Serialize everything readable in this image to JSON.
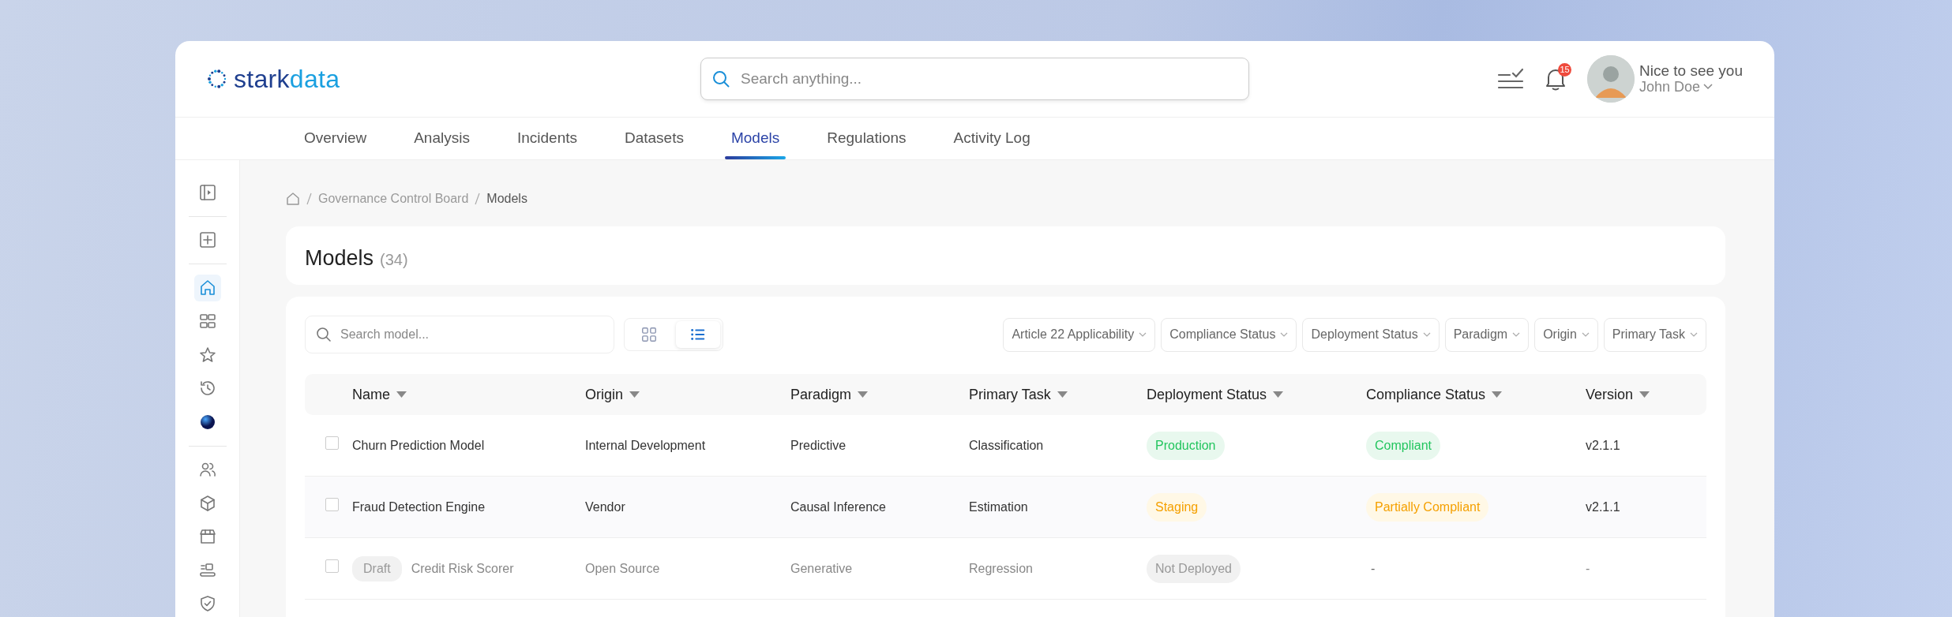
{
  "header": {
    "logo_text": [
      "stark",
      "data"
    ],
    "search": {
      "placeholder": "Search anything..."
    },
    "notifications": {
      "count": "15"
    },
    "user": {
      "greeting": "Nice to see you",
      "name": "John Doe"
    }
  },
  "tabs": [
    {
      "label": "Overview",
      "selected": false
    },
    {
      "label": "Analysis",
      "selected": false
    },
    {
      "label": "Incidents",
      "selected": false
    },
    {
      "label": "Datasets",
      "selected": false
    },
    {
      "label": "Models",
      "selected": true
    },
    {
      "label": "Regulations",
      "selected": false
    },
    {
      "label": "Activity Log",
      "selected": false
    }
  ],
  "sidebar": {
    "items": [
      {
        "selected": false
      },
      {
        "selected": false
      },
      {
        "selected": true
      },
      {
        "selected": false
      },
      {
        "selected": false
      },
      {
        "selected": false
      },
      {
        "selected": false
      },
      {
        "selected": false
      },
      {
        "selected": false
      },
      {
        "selected": false
      },
      {
        "selected": false
      },
      {
        "selected": false
      }
    ]
  },
  "breadcrumb": [
    "Governance Control Board",
    "Models"
  ],
  "page": {
    "title": "Models",
    "count": "(34)"
  },
  "toolbar": {
    "search": {
      "placeholder": "Search model..."
    },
    "views": [
      {
        "kind": "grid",
        "selected": false
      },
      {
        "kind": "list",
        "selected": true
      }
    ],
    "filters": [
      "Article 22 Applicability",
      "Compliance Status",
      "Deployment Status",
      "Paradigm",
      "Origin",
      "Primary Task"
    ]
  },
  "table": {
    "columns": [
      "Name",
      "Origin",
      "Paradigm",
      "Primary Task",
      "Deployment Status",
      "Compliance Status",
      "Version"
    ],
    "rows": [
      {
        "checked": false,
        "draft": false,
        "name": "Churn Prediction Model",
        "origin": "Internal Development",
        "paradigm": "Predictive",
        "primary_task": "Classification",
        "deployment": {
          "label": "Production",
          "kind": "success"
        },
        "compliance": {
          "label": "Compliant",
          "kind": "success"
        },
        "version": "v2.1.1"
      },
      {
        "checked": false,
        "draft": false,
        "name": "Fraud Detection Engine",
        "origin": "Vendor",
        "paradigm": "Causal Inference",
        "primary_task": "Estimation",
        "deployment": {
          "label": "Staging",
          "kind": "warning"
        },
        "compliance": {
          "label": "Partially Compliant",
          "kind": "warning"
        },
        "version": "v2.1.1"
      },
      {
        "checked": false,
        "draft": true,
        "draft_label": "Draft",
        "name": "Credit Risk Scorer",
        "origin": "Open Source",
        "paradigm": "Generative",
        "primary_task": "Regression",
        "deployment": {
          "label": "Not Deployed",
          "kind": "muted"
        },
        "compliance": {
          "label": "-",
          "kind": "none"
        },
        "version": "-"
      }
    ]
  }
}
